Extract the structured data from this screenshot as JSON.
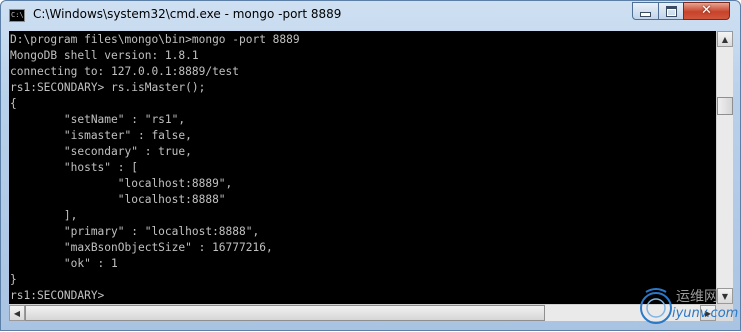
{
  "window": {
    "title": "C:\\Windows\\system32\\cmd.exe - mongo  -port 8889",
    "icon": "cmd-icon",
    "icon_text": "C:\\",
    "close_glyph": "✕"
  },
  "console": {
    "lines": [
      "D:\\program files\\mongo\\bin>mongo -port 8889",
      "MongoDB shell version: 1.8.1",
      "connecting to: 127.0.0.1:8889/test",
      "rs1:SECONDARY> rs.isMaster();",
      "{",
      "        \"setName\" : \"rs1\",",
      "        \"ismaster\" : false,",
      "        \"secondary\" : true,",
      "        \"hosts\" : [",
      "                \"localhost:8889\",",
      "                \"localhost:8888\"",
      "        ],",
      "        \"primary\" : \"localhost:8888\",",
      "        \"maxBsonObjectSize\" : 16777216,",
      "        \"ok\" : 1",
      "}",
      "rs1:SECONDARY>"
    ]
  },
  "watermark": {
    "line1": "运维网",
    "line2": "iyunv.com"
  }
}
